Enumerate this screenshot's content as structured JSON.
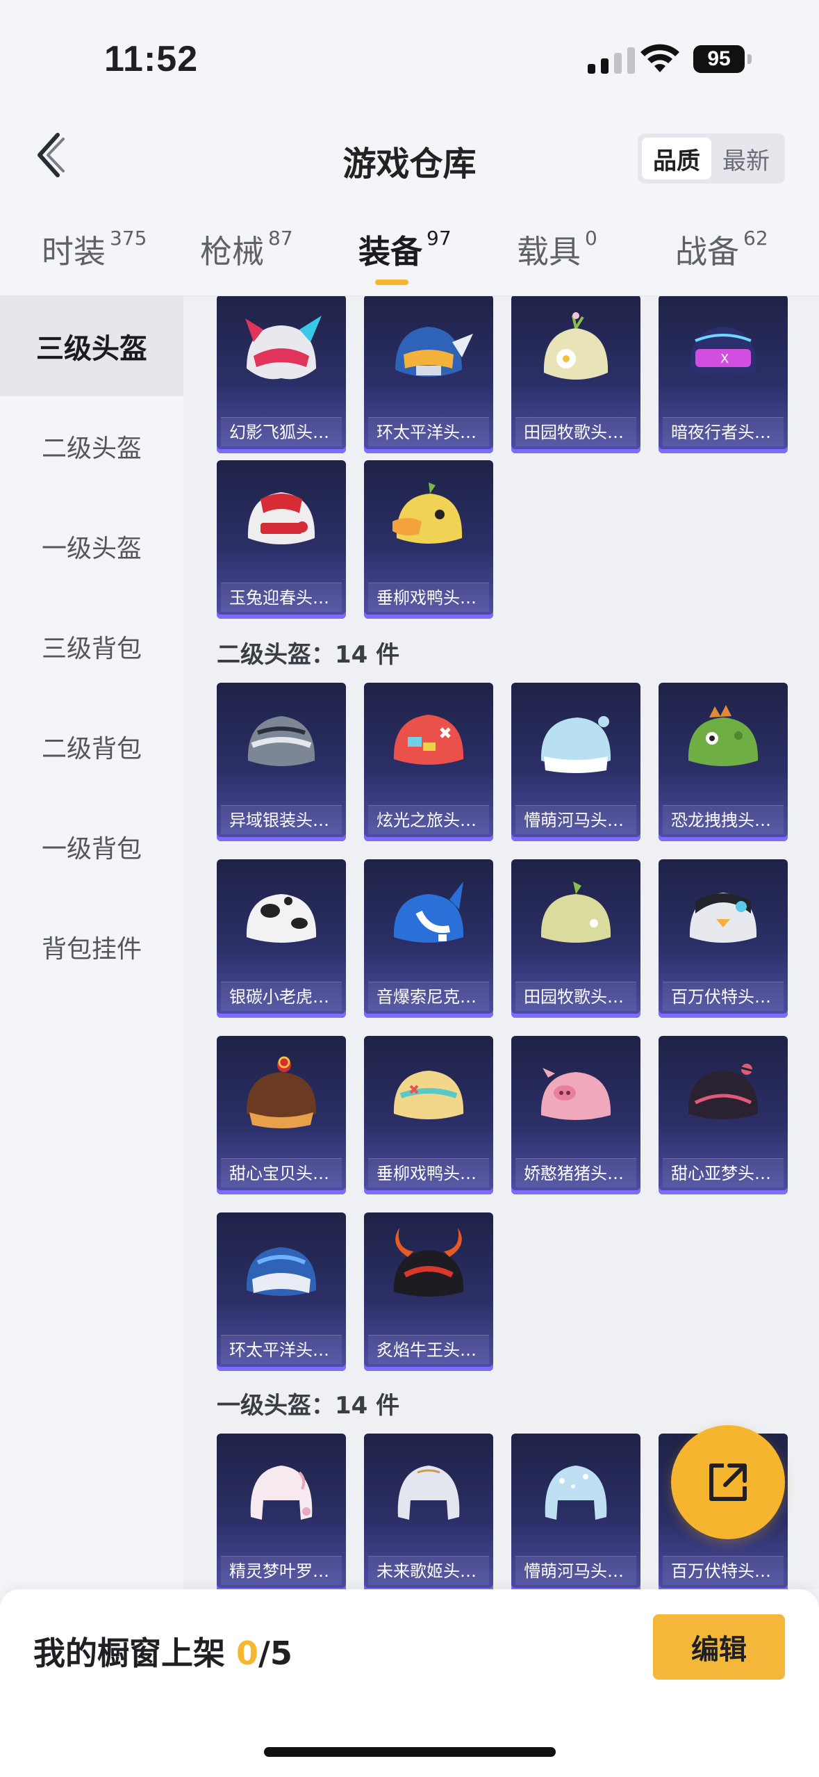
{
  "status": {
    "time": "11:52",
    "battery": "95"
  },
  "nav": {
    "title": "游戏仓库",
    "sort_quality": "品质",
    "sort_latest": "最新"
  },
  "tabs": [
    {
      "label": "时装",
      "count": "375"
    },
    {
      "label": "枪械",
      "count": "87"
    },
    {
      "label": "装备",
      "count": "97"
    },
    {
      "label": "载具",
      "count": "0"
    },
    {
      "label": "战备",
      "count": "62"
    }
  ],
  "sidebar": [
    "三级头盔",
    "二级头盔",
    "一级头盔",
    "三级背包",
    "二级背包",
    "一级背包",
    "背包挂件"
  ],
  "sections": {
    "level3": {
      "items": [
        "幻影飞狐头…",
        "环太平洋头…",
        "田园牧歌头…",
        "暗夜行者头…",
        "玉兔迎春头…",
        "垂柳戏鸭头…"
      ]
    },
    "level2": {
      "title": "二级头盔：14 件",
      "items": [
        "异域银装头…",
        "炫光之旅头…",
        "懵萌河马头…",
        "恐龙拽拽头…",
        "银碳小老虎…",
        "音爆索尼克…",
        "田园牧歌头…",
        "百万伏特头…",
        "甜心宝贝头…",
        "垂柳戏鸭头…",
        "娇憨猪猪头…",
        "甜心亚梦头…",
        "环太平洋头…",
        "炙焰牛王头…"
      ]
    },
    "level1": {
      "title": "一级头盔：14 件",
      "items": [
        "精灵梦叶罗…",
        "未来歌姬头…",
        "懵萌河马头…",
        "百万伏特头…"
      ]
    }
  },
  "bottom": {
    "shelf_label": "我的橱窗上架 ",
    "shelf_count": "0",
    "shelf_total": "/5",
    "edit_label": "编辑"
  }
}
